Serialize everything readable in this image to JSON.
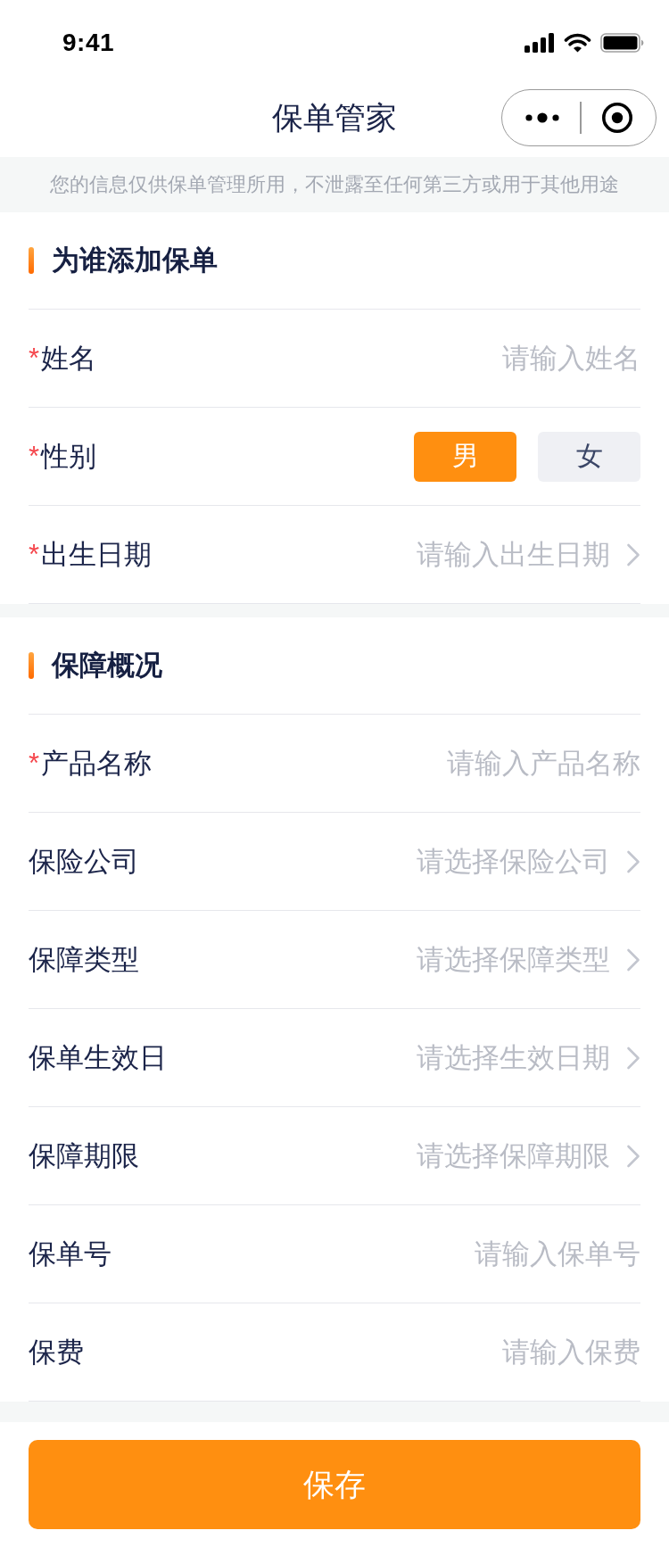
{
  "status_bar": {
    "time": "9:41"
  },
  "nav_bar": {
    "title": "保单管家"
  },
  "notice": "您的信息仅供保单管理所用，不泄露至任何第三方或用于其他用途",
  "sections": [
    {
      "title": "为谁添加保单",
      "fields": [
        {
          "kind": "input",
          "required_mark": "*",
          "label": "姓名",
          "placeholder": "请输入姓名"
        },
        {
          "kind": "choice",
          "required_mark": "*",
          "label": "性别",
          "options": [
            {
              "label": "男",
              "selected": true
            },
            {
              "label": "女",
              "selected": false
            }
          ]
        },
        {
          "kind": "picker",
          "required_mark": "*",
          "label": "出生日期",
          "placeholder": "请输入出生日期"
        }
      ]
    },
    {
      "title": "保障概况",
      "fields": [
        {
          "kind": "input",
          "required_mark": "*",
          "label": "产品名称",
          "placeholder": "请输入产品名称"
        },
        {
          "kind": "picker",
          "label": "保险公司",
          "placeholder": "请选择保险公司"
        },
        {
          "kind": "picker",
          "label": "保障类型",
          "placeholder": "请选择保障类型"
        },
        {
          "kind": "picker",
          "label": "保单生效日",
          "placeholder": "请选择生效日期"
        },
        {
          "kind": "picker",
          "label": "保障期限",
          "placeholder": "请选择保障期限"
        },
        {
          "kind": "input",
          "label": "保单号",
          "placeholder": "请输入保单号"
        },
        {
          "kind": "input",
          "label": "保费",
          "placeholder": "请输入保费"
        }
      ]
    }
  ],
  "save_button": {
    "label": "保存"
  }
}
